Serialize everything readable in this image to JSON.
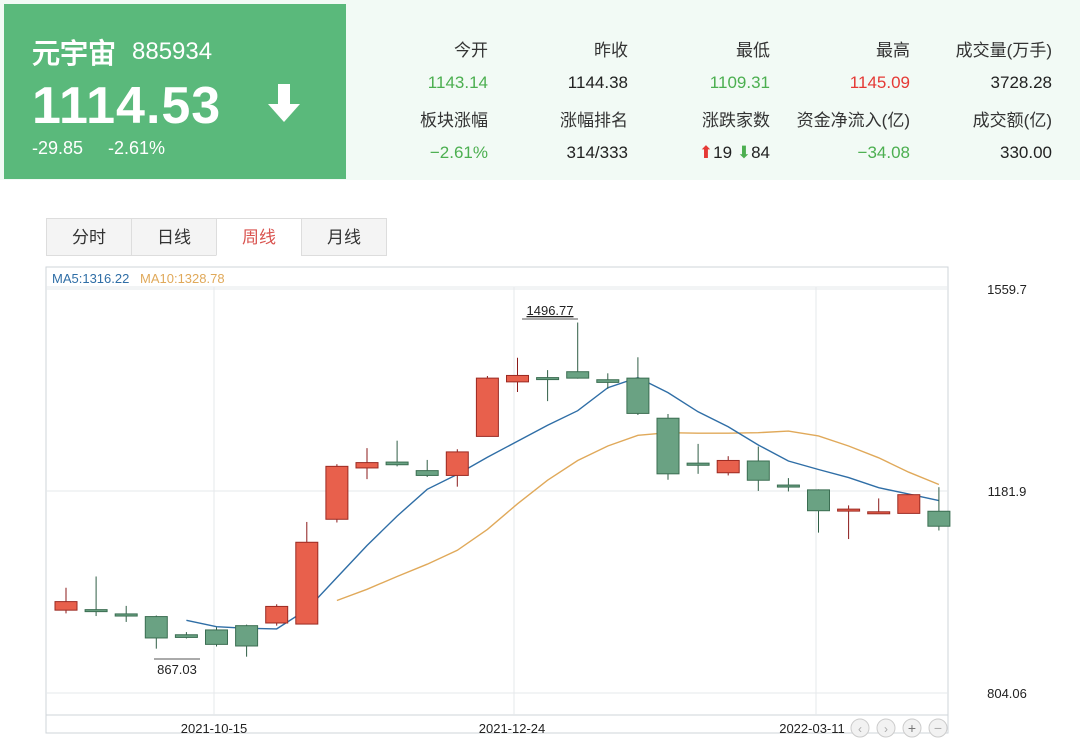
{
  "sector": {
    "name": "元宇宙",
    "code": "885934"
  },
  "quote": {
    "price": "1114.53",
    "change": "-29.85",
    "change_pct": "-2.61%",
    "direction_icon": "arrow-down-icon"
  },
  "stats": [
    {
      "label": "今开",
      "value": "1143.14",
      "color": "#4caf50"
    },
    {
      "label": "昨收",
      "value": "1144.38",
      "color": "#222222"
    },
    {
      "label": "最低",
      "value": "1109.31",
      "color": "#4caf50"
    },
    {
      "label": "最高",
      "value": "1145.09",
      "color": "#e53935"
    },
    {
      "label": "成交量(万手)",
      "value": "3728.28",
      "color": "#222222"
    },
    {
      "label": "板块涨幅",
      "value": "−2.61%",
      "color": "#4caf50"
    },
    {
      "label": "涨幅排名",
      "value": "314/333",
      "color": "#222222"
    },
    {
      "label": "涨跌家数",
      "value": "",
      "color": "#222222"
    },
    {
      "label": "资金净流入(亿)",
      "value": "−34.08",
      "color": "#4caf50"
    },
    {
      "label": "成交额(亿)",
      "value": "330.00",
      "color": "#222222"
    }
  ],
  "breadth": {
    "up": "19",
    "down": "84"
  },
  "tabs": [
    "分时",
    "日线",
    "周线",
    "月线"
  ],
  "active_tab": "周线",
  "colors": {
    "up": "#e8604c",
    "down": "#6aa283",
    "ma5": "#2f6ea6",
    "ma10": "#e0a95a"
  },
  "chart_data": {
    "type": "candlestick",
    "legend": {
      "ma5": "MA5:1316.22",
      "ma10": "MA10:1328.78"
    },
    "ylim": [
      804.06,
      1559.7
    ],
    "y_ticks": [
      "1559.7",
      "1181.9",
      "804.06"
    ],
    "x_ticks": [
      "2021-10-15",
      "2021-12-24",
      "2022-03-11"
    ],
    "annotations": {
      "high": "1496.77",
      "low": "867.03"
    },
    "candles": [
      {
        "o": 959,
        "c": 975,
        "h": 1001,
        "l": 953
      },
      {
        "o": 960,
        "c": 958,
        "h": 1022,
        "l": 948
      },
      {
        "o": 952,
        "c": 948,
        "h": 967,
        "l": 937
      },
      {
        "o": 947,
        "c": 907,
        "h": 949,
        "l": 887
      },
      {
        "o": 913,
        "c": 908,
        "h": 918,
        "l": 906
      },
      {
        "o": 922,
        "c": 895,
        "h": 927,
        "l": 891
      },
      {
        "o": 930,
        "c": 892,
        "h": 932,
        "l": 872
      },
      {
        "o": 935,
        "c": 966,
        "h": 970,
        "l": 930
      },
      {
        "o": 933,
        "c": 1086,
        "h": 1124,
        "l": 933
      },
      {
        "o": 1129,
        "c": 1228,
        "h": 1232,
        "l": 1123
      },
      {
        "o": 1225,
        "c": 1235,
        "h": 1262,
        "l": 1204
      },
      {
        "o": 1236,
        "c": 1231,
        "h": 1276,
        "l": 1228
      },
      {
        "o": 1220,
        "c": 1211,
        "h": 1240,
        "l": 1208
      },
      {
        "o": 1211,
        "c": 1255,
        "h": 1260,
        "l": 1190
      },
      {
        "o": 1284,
        "c": 1393,
        "h": 1397,
        "l": 1284
      },
      {
        "o": 1386,
        "c": 1398,
        "h": 1431,
        "l": 1367
      },
      {
        "o": 1394,
        "c": 1393,
        "h": 1408,
        "l": 1350
      },
      {
        "o": 1405,
        "c": 1393,
        "h": 1497,
        "l": 1392
      },
      {
        "o": 1390,
        "c": 1385,
        "h": 1402,
        "l": 1373
      },
      {
        "o": 1393,
        "c": 1327,
        "h": 1432,
        "l": 1324
      },
      {
        "o": 1318,
        "c": 1214,
        "h": 1326,
        "l": 1203
      },
      {
        "o": 1234,
        "c": 1230,
        "h": 1270,
        "l": 1214
      },
      {
        "o": 1216,
        "c": 1239,
        "h": 1247,
        "l": 1211
      },
      {
        "o": 1238,
        "c": 1202,
        "h": 1265,
        "l": 1182
      },
      {
        "o": 1193,
        "c": 1191,
        "h": 1206,
        "l": 1181
      },
      {
        "o": 1184,
        "c": 1145,
        "h": 1185,
        "l": 1104
      },
      {
        "o": 1148,
        "c": 1148,
        "h": 1155,
        "l": 1092
      },
      {
        "o": 1142,
        "c": 1143,
        "h": 1168,
        "l": 1139
      },
      {
        "o": 1140,
        "c": 1175,
        "h": 1175,
        "l": 1141
      },
      {
        "o": 1144,
        "c": 1116,
        "h": 1189,
        "l": 1108
      }
    ],
    "ma5": [
      {
        "i": 4,
        "v": 940
      },
      {
        "i": 5,
        "v": 928
      },
      {
        "i": 6,
        "v": 925
      },
      {
        "i": 7,
        "v": 924
      },
      {
        "i": 8,
        "v": 960
      },
      {
        "i": 9,
        "v": 1020
      },
      {
        "i": 10,
        "v": 1080
      },
      {
        "i": 11,
        "v": 1135
      },
      {
        "i": 12,
        "v": 1185
      },
      {
        "i": 13,
        "v": 1213
      },
      {
        "i": 14,
        "v": 1245
      },
      {
        "i": 15,
        "v": 1275
      },
      {
        "i": 16,
        "v": 1305
      },
      {
        "i": 17,
        "v": 1332
      },
      {
        "i": 18,
        "v": 1375
      },
      {
        "i": 19,
        "v": 1394
      },
      {
        "i": 20,
        "v": 1366
      },
      {
        "i": 21,
        "v": 1330
      },
      {
        "i": 22,
        "v": 1302
      },
      {
        "i": 23,
        "v": 1268
      },
      {
        "i": 24,
        "v": 1238
      },
      {
        "i": 25,
        "v": 1222
      },
      {
        "i": 26,
        "v": 1207
      },
      {
        "i": 27,
        "v": 1188
      },
      {
        "i": 28,
        "v": 1176
      },
      {
        "i": 29,
        "v": 1164
      }
    ],
    "ma10": [
      {
        "i": 9,
        "v": 977
      },
      {
        "i": 10,
        "v": 998
      },
      {
        "i": 11,
        "v": 1022
      },
      {
        "i": 12,
        "v": 1045
      },
      {
        "i": 13,
        "v": 1071
      },
      {
        "i": 14,
        "v": 1110
      },
      {
        "i": 15,
        "v": 1158
      },
      {
        "i": 16,
        "v": 1202
      },
      {
        "i": 17,
        "v": 1239
      },
      {
        "i": 18,
        "v": 1266
      },
      {
        "i": 19,
        "v": 1286
      },
      {
        "i": 20,
        "v": 1291
      },
      {
        "i": 21,
        "v": 1290
      },
      {
        "i": 22,
        "v": 1290
      },
      {
        "i": 23,
        "v": 1291
      },
      {
        "i": 24,
        "v": 1294
      },
      {
        "i": 25,
        "v": 1285
      },
      {
        "i": 26,
        "v": 1266
      },
      {
        "i": 27,
        "v": 1244
      },
      {
        "i": 28,
        "v": 1217
      },
      {
        "i": 29,
        "v": 1194
      }
    ],
    "grid": true
  }
}
